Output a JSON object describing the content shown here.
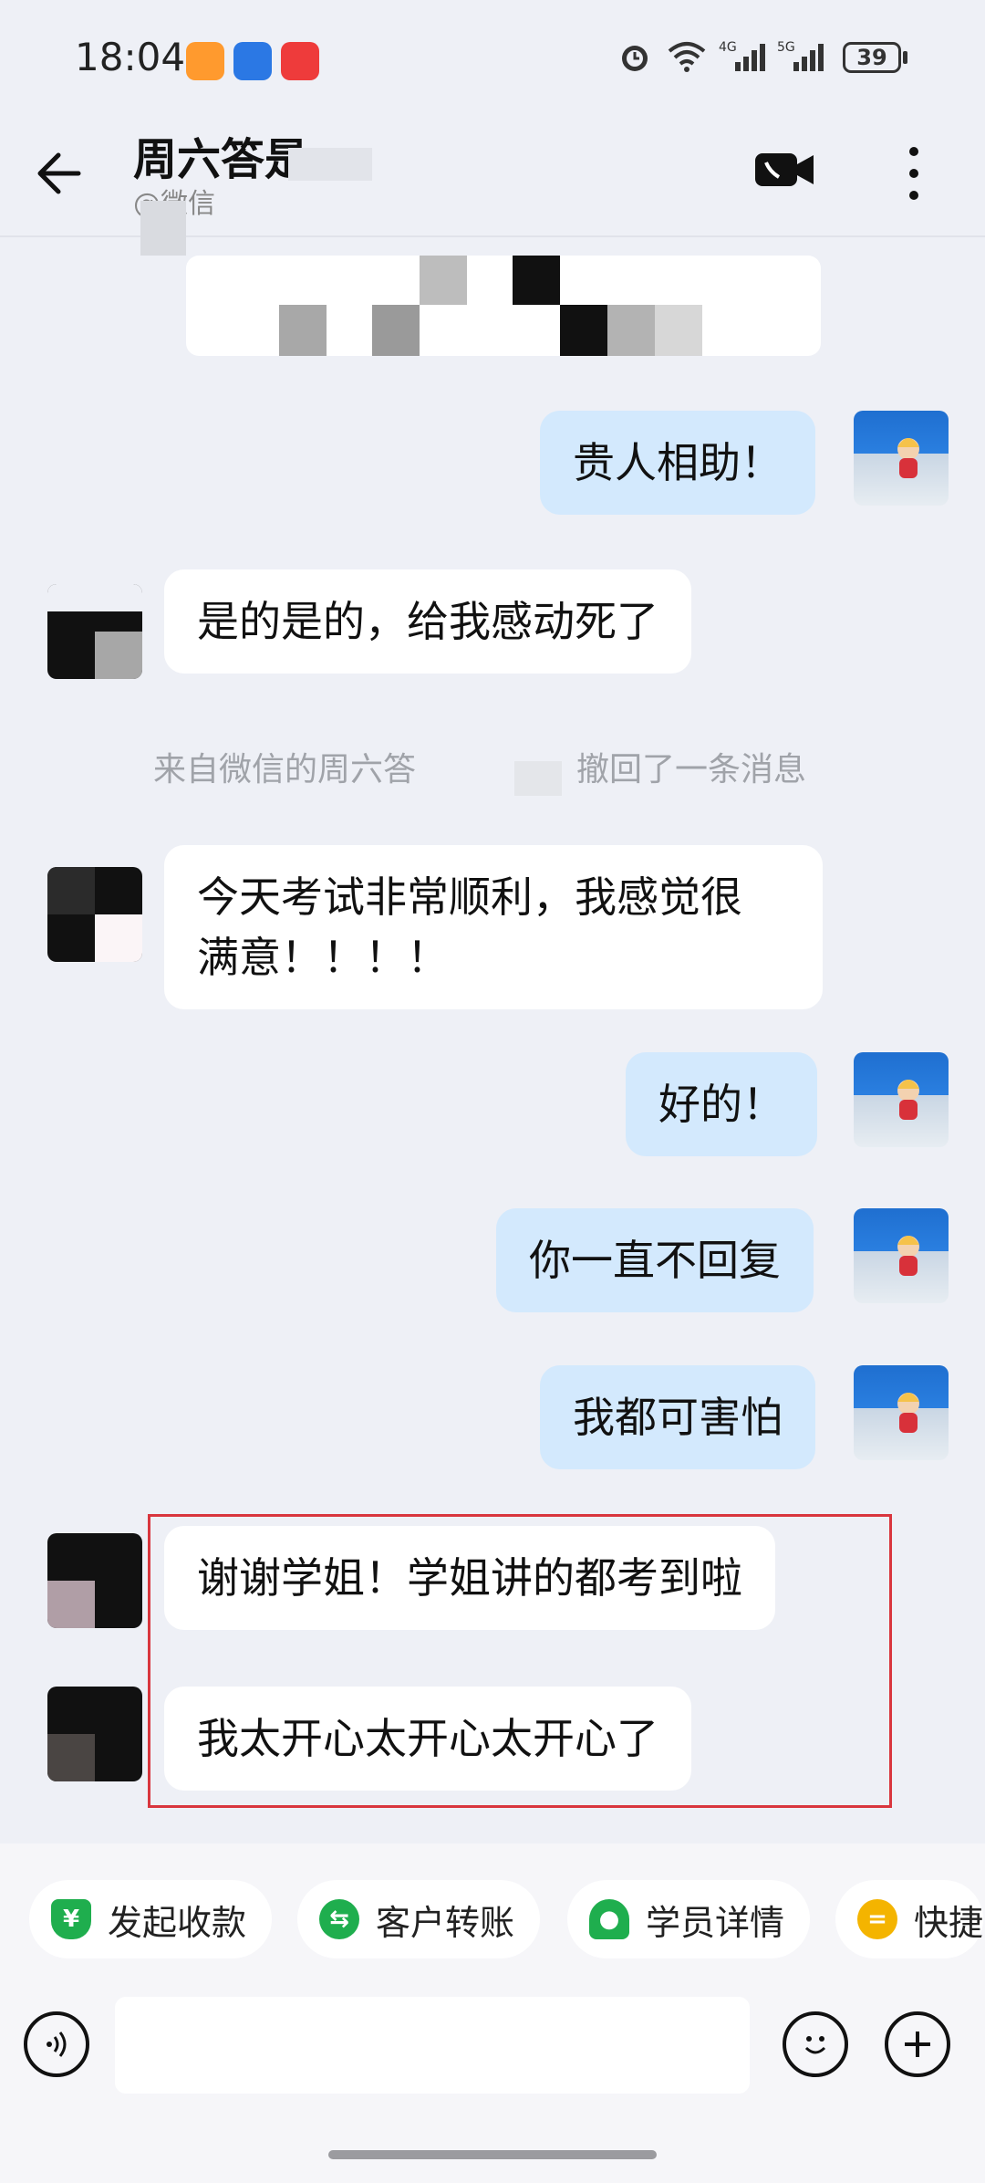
{
  "status_bar": {
    "time": "18:04",
    "battery": "39"
  },
  "header": {
    "title": "周六答是",
    "subtitle": "@微信"
  },
  "messages": {
    "m1": "贵人相助！",
    "m2": "是的是的，给我感动死了",
    "recall_left": "来自微信的周六答",
    "recall_right": "撤回了一条消息",
    "m3_line1": "今天考试非常顺利，我感觉很",
    "m3_line2": "满意！！！！",
    "m4": "好的！",
    "m5": "你一直不回复",
    "m6": "我都可害怕",
    "m7": "谢谢学姐！学姐讲的都考到啦",
    "m8": "我太开心太开心太开心了"
  },
  "quick_actions": [
    "发起收款",
    "客户转账",
    "学员详情",
    "快捷"
  ],
  "colors": {
    "out_bubble": "#d3e9fd",
    "in_bubble": "#ffffff",
    "highlight": "#d9363e",
    "chip_icon": "#1fae4e",
    "quick_icon": "#f4b400"
  }
}
